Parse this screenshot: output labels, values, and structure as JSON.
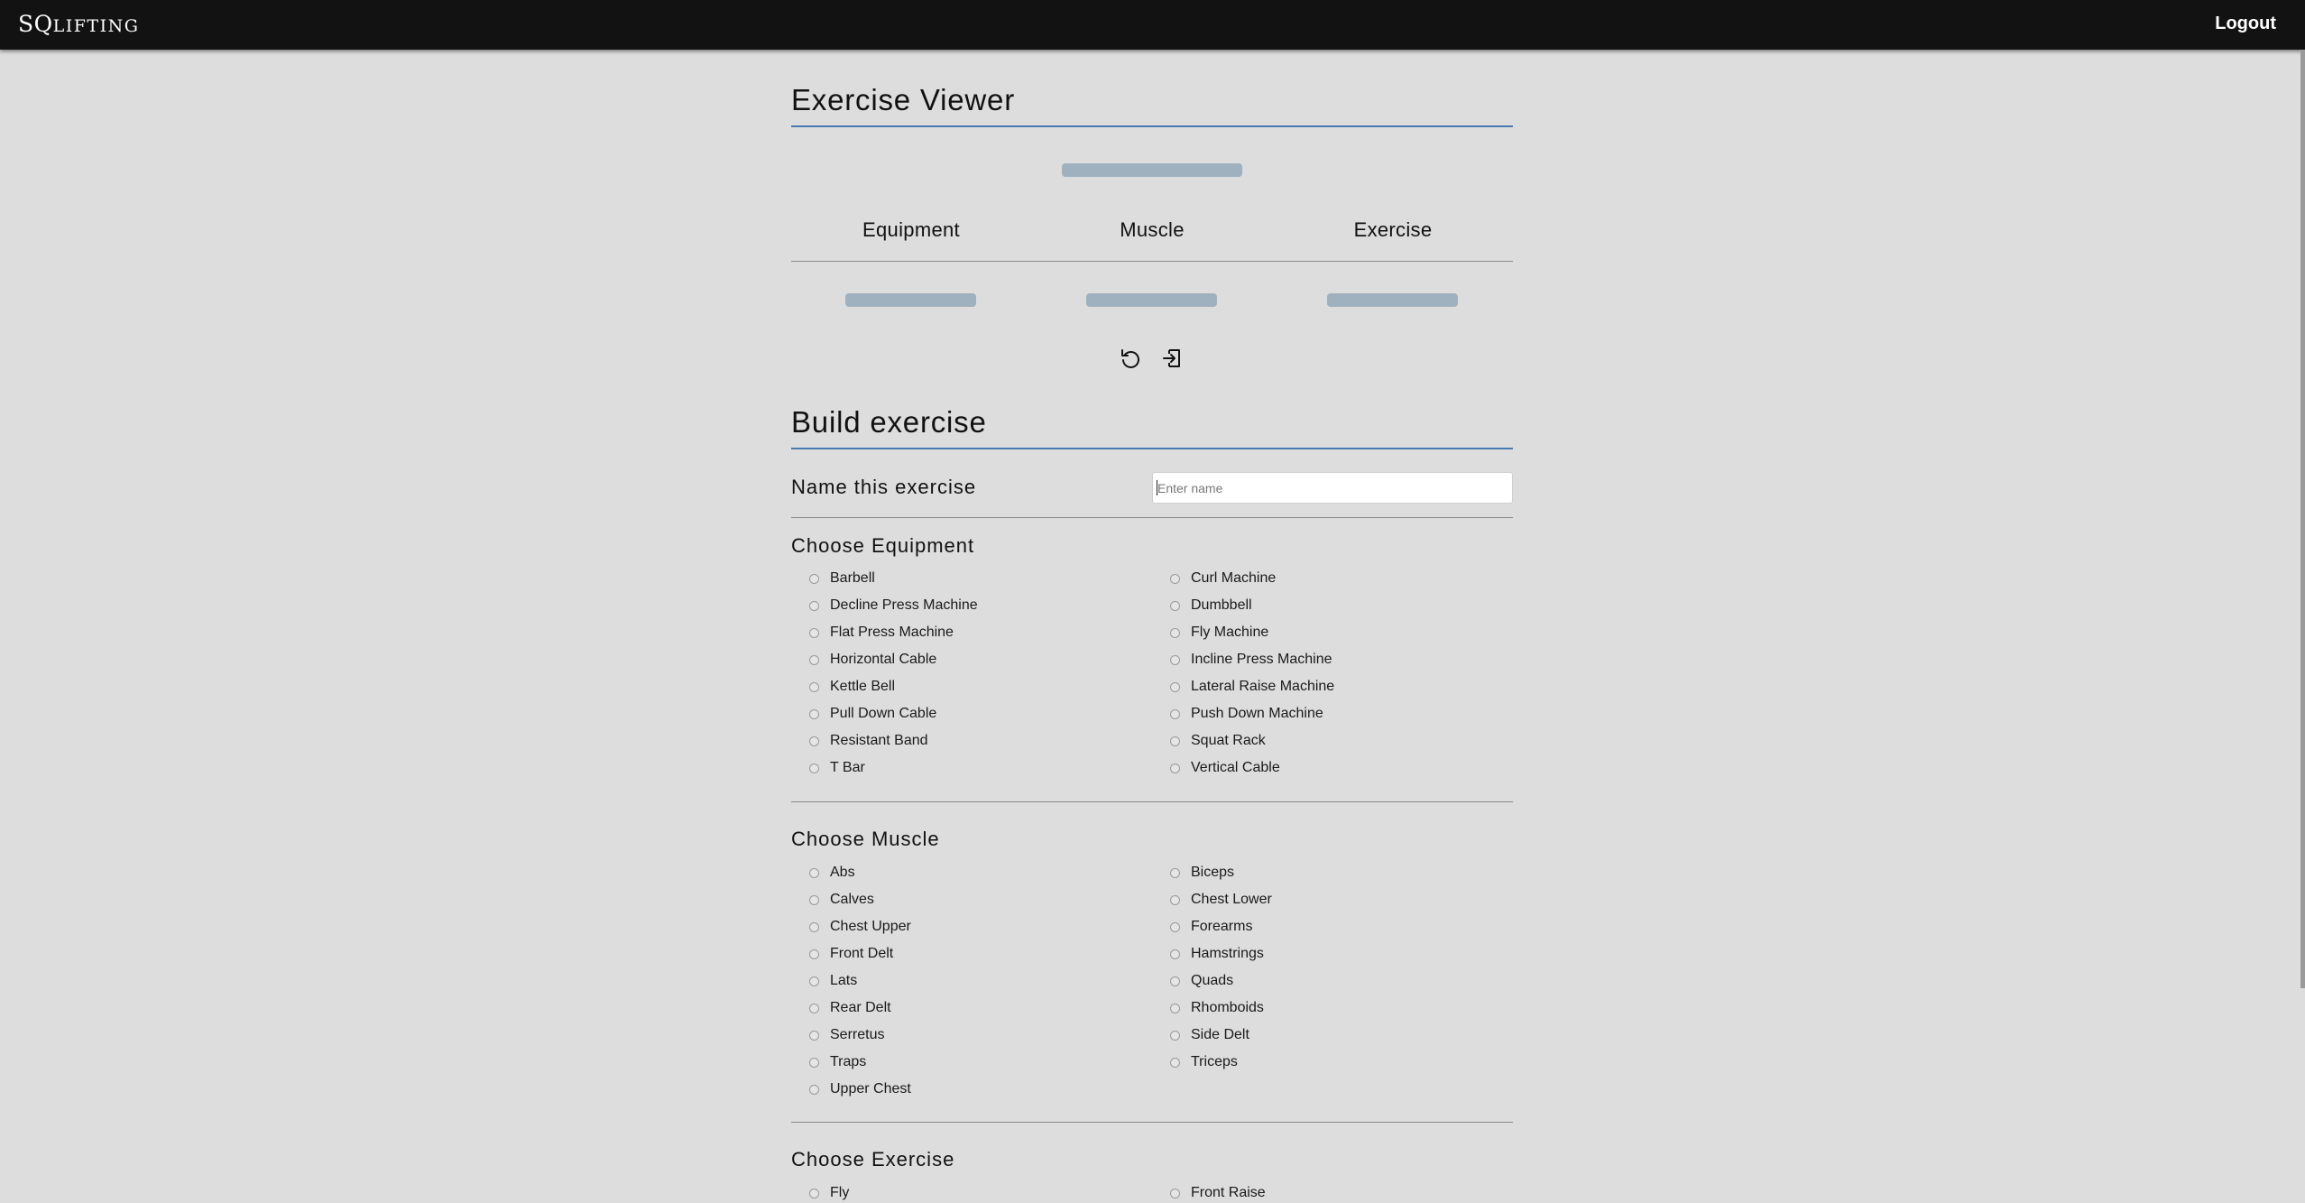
{
  "header": {
    "brand_prefix": "SQ",
    "brand_rest": "LIFTING",
    "logout_label": "Logout"
  },
  "viewer": {
    "title": "Exercise Viewer",
    "columns": [
      "Equipment",
      "Muscle",
      "Exercise"
    ],
    "reset_icon": "refresh-icon",
    "enter_icon": "enter-icon"
  },
  "build": {
    "title": "Build exercise",
    "name_label": "Name this exercise",
    "name_placeholder": "Enter name",
    "name_value": ""
  },
  "equipment": {
    "title": "Choose Equipment",
    "options": [
      "Barbell",
      "Curl Machine",
      "Decline Press Machine",
      "Dumbbell",
      "Flat Press Machine",
      "Fly Machine",
      "Horizontal Cable",
      "Incline Press Machine",
      "Kettle Bell",
      "Lateral Raise Machine",
      "Pull Down Cable",
      "Push Down Machine",
      "Resistant Band",
      "Squat Rack",
      "T Bar",
      "Vertical Cable"
    ]
  },
  "muscle": {
    "title": "Choose Muscle",
    "options": [
      "Abs",
      "Biceps",
      "Calves",
      "Chest Lower",
      "Chest Upper",
      "Forearms",
      "Front Delt",
      "Hamstrings",
      "Lats",
      "Quads",
      "Rear Delt",
      "Rhomboids",
      "Serretus",
      "Side Delt",
      "Traps",
      "Triceps",
      "Upper Chest"
    ]
  },
  "exercise": {
    "title": "Choose Exercise",
    "options": [
      "Fly",
      "Front Raise"
    ]
  },
  "colors": {
    "topbar": "#121212",
    "background": "#dddddd",
    "accent_rule": "#4a7ab0",
    "skeleton": "#9fb0bf"
  }
}
